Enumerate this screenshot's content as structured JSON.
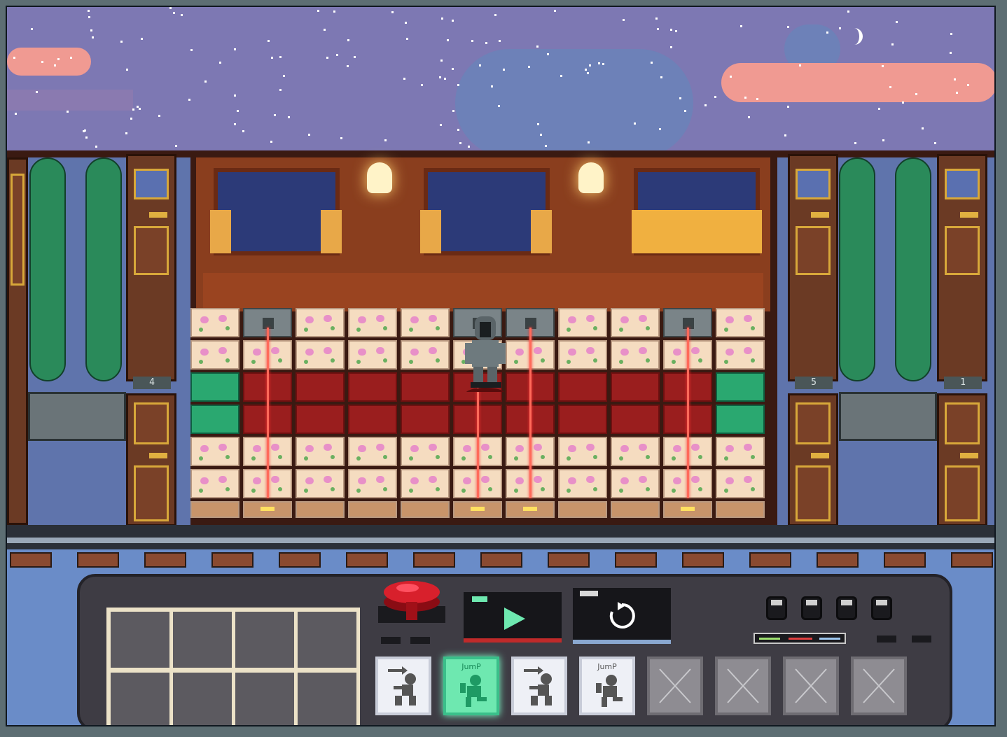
{
  "game": {
    "car_numbers": [
      "4",
      "5",
      "1"
    ],
    "colors": {
      "sky": "#7d78b3",
      "cloud_pink": "#f09a92",
      "laser": "#ff6a5a",
      "carpet": "#9a1e1e",
      "goal": "#2aa870",
      "console": "#3e3c44"
    }
  },
  "controls": {
    "run_button_icon": "big-red-button",
    "play_icon": "play-triangle-icon",
    "reset_icon": "reset-arrow-icon",
    "knob_count": 4
  },
  "command_queue": [
    {
      "type": "move",
      "label": "",
      "icon": "run-right-icon",
      "active": false
    },
    {
      "type": "jump",
      "label": "JumP",
      "icon": "jump-icon",
      "active": true
    },
    {
      "type": "move",
      "label": "",
      "icon": "run-right-icon",
      "active": false
    },
    {
      "type": "jump",
      "label": "JumP",
      "icon": "jump-icon",
      "active": false
    },
    {
      "type": "empty",
      "label": "",
      "icon": "empty-x-icon",
      "active": false
    },
    {
      "type": "empty",
      "label": "",
      "icon": "empty-x-icon",
      "active": false
    },
    {
      "type": "empty",
      "label": "",
      "icon": "empty-x-icon",
      "active": false
    },
    {
      "type": "empty",
      "label": "",
      "icon": "empty-x-icon",
      "active": false
    }
  ],
  "inventory_slots": 8
}
